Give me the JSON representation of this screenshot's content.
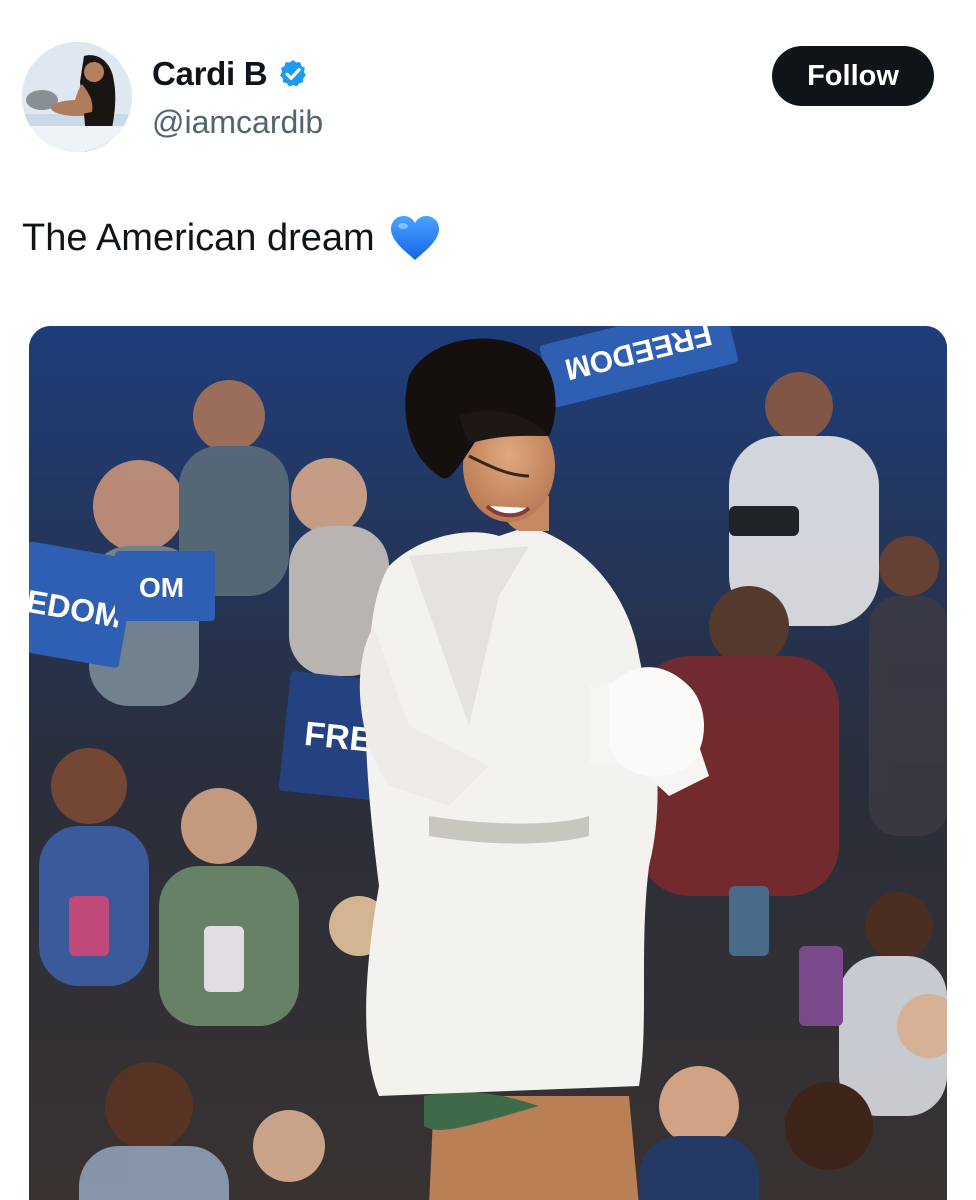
{
  "author": {
    "display_name": "Cardi B",
    "handle": "@iamcardib",
    "verified": true,
    "avatar_icon": "profile-photo",
    "verified_icon": "verified-badge-icon",
    "verified_color": "#1d9bf0"
  },
  "actions": {
    "follow_label": "Follow"
  },
  "tweet": {
    "text": "The American dream",
    "emoji_icon": "blue-heart-icon"
  },
  "media": {
    "signs": {
      "sign_1": "FREEDOM",
      "sign_2": "EDOM",
      "sign_3": "OM",
      "sign_4": "FRE"
    }
  },
  "colors": {
    "follow_bg": "#0f1419",
    "follow_text": "#ffffff",
    "handle": "#536471",
    "heart": "#1d7bf2",
    "sign_blue": "#2f5fb3"
  }
}
